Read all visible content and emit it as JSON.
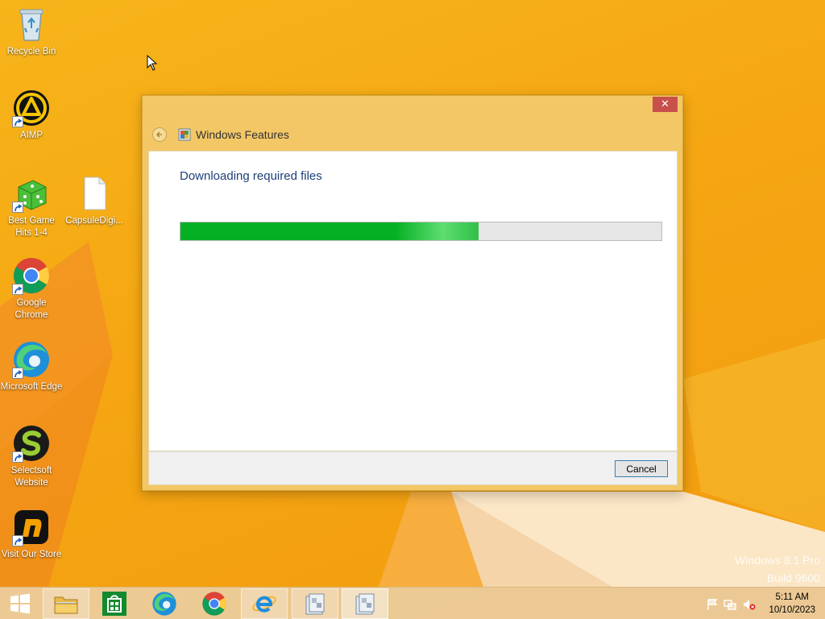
{
  "desktop": {
    "icons": [
      {
        "label": "Recycle Bin",
        "icon": "recycle-bin-icon"
      },
      {
        "label": "AIMP",
        "icon": "aimp-icon"
      },
      {
        "label": "Best Game Hits 1-4",
        "icon": "dice-icon"
      },
      {
        "label": "CapsuleDigi...",
        "icon": "file-icon"
      },
      {
        "label": "Google Chrome",
        "icon": "chrome-icon"
      },
      {
        "label": "Microsoft Edge",
        "icon": "edge-icon"
      },
      {
        "label": "Selectsoft Website",
        "icon": "selectsoft-icon"
      },
      {
        "label": "Visit Our Store",
        "icon": "store-icon"
      }
    ]
  },
  "dialog": {
    "title": "Windows Features",
    "close_label": "✕",
    "status": "Downloading required files",
    "progress_percent": 62,
    "cancel_label": "Cancel"
  },
  "watermark": {
    "line1": "Windows 8.1 Pro",
    "line2": "Build 9600"
  },
  "taskbar": {
    "items": [
      "start-icon",
      "file-explorer-icon",
      "store-icon",
      "edge-icon",
      "chrome-icon",
      "internet-explorer-icon",
      "windows-features-icon",
      "windows-features-icon"
    ],
    "time": "5:11 AM",
    "date": "10/10/2023"
  },
  "colors": {
    "wallpaper": "#f5a612",
    "dialog_frame": "#f3c766",
    "progress": "#06b025",
    "close": "#c7504b",
    "status_text": "#1e3f7a"
  }
}
